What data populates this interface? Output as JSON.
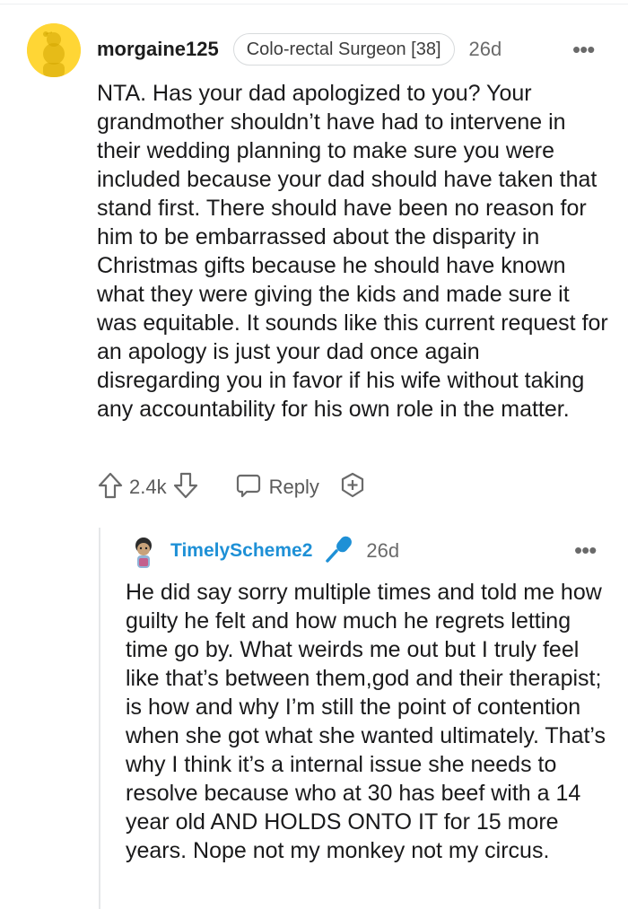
{
  "comment": {
    "username": "morgaine125",
    "flair": "Colo-rectal Surgeon [38]",
    "age": "26d",
    "more": "•••",
    "body": "NTA. Has your dad apologized to you? Your grandmother shouldn’t have had to intervene in their wedding planning to make sure you were included because your dad should have taken that stand first. There should have been no reason for him to be embarrassed about the disparity in Christmas gifts because he should have known what they were giving the kids and made sure it was equitable. It sounds like this current request for an apology is just your dad once again disregarding you in favor if his wife without taking any accountability for his own role in the matter.",
    "score": "2.4k",
    "reply_label": "Reply",
    "avatar_color": "#ffd635"
  },
  "reply": {
    "username": "TimelyScheme2",
    "age": "26d",
    "more": "•••",
    "username_color": "#1e90d6",
    "body": "He did say sorry multiple times and told me how guilty he felt and how much he regrets letting time go by. What weirds me out but I truly feel like that’s between them,god and their therapist; is how and why I’m still the point of contention when she got what she wanted ultimately. That’s why I think it’s a internal issue she needs to resolve because who at 30 has beef with a 14 year old AND HOLDS ONTO IT for 15 more years. Nope not my monkey not my circus."
  },
  "icons": {
    "avatar": "snoo-avatar-icon",
    "upvote": "upvote-arrow-icon",
    "downvote": "downvote-arrow-icon",
    "reply": "speech-bubble-icon",
    "award": "award-plus-icon",
    "mic": "microphone-icon",
    "more": "more-options-icon"
  }
}
